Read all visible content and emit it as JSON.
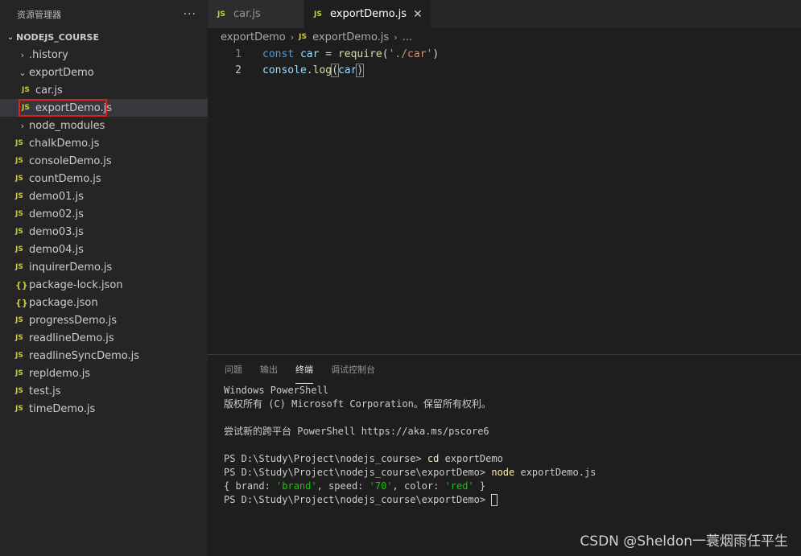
{
  "sidebar": {
    "title": "资源管理器",
    "more": "···",
    "section": "NODEJS_COURSE",
    "items": [
      {
        "label": ".history",
        "type": "folder",
        "open": false,
        "indent": 1
      },
      {
        "label": "exportDemo",
        "type": "folder",
        "open": true,
        "indent": 1
      },
      {
        "label": "car.js",
        "type": "js",
        "indent": 2
      },
      {
        "label": "exportDemo.js",
        "type": "js",
        "indent": 2,
        "selected": true
      },
      {
        "label": "node_modules",
        "type": "folder",
        "open": false,
        "indent": 1
      },
      {
        "label": "chalkDemo.js",
        "type": "js",
        "indent": 1
      },
      {
        "label": "consoleDemo.js",
        "type": "js",
        "indent": 1
      },
      {
        "label": "countDemo.js",
        "type": "js",
        "indent": 1
      },
      {
        "label": "demo01.js",
        "type": "js",
        "indent": 1
      },
      {
        "label": "demo02.js",
        "type": "js",
        "indent": 1
      },
      {
        "label": "demo03.js",
        "type": "js",
        "indent": 1
      },
      {
        "label": "demo04.js",
        "type": "js",
        "indent": 1
      },
      {
        "label": "inquirerDemo.js",
        "type": "js",
        "indent": 1
      },
      {
        "label": "package-lock.json",
        "type": "json",
        "indent": 1
      },
      {
        "label": "package.json",
        "type": "json",
        "indent": 1
      },
      {
        "label": "progressDemo.js",
        "type": "js",
        "indent": 1
      },
      {
        "label": "readlineDemo.js",
        "type": "js",
        "indent": 1
      },
      {
        "label": "readlineSyncDemo.js",
        "type": "js",
        "indent": 1
      },
      {
        "label": "repldemo.js",
        "type": "js",
        "indent": 1
      },
      {
        "label": "test.js",
        "type": "js",
        "indent": 1
      },
      {
        "label": "timeDemo.js",
        "type": "js",
        "indent": 1
      }
    ]
  },
  "icons": {
    "js": "JS",
    "json": "{}",
    "chevron_right": "›",
    "chevron_down": "⌄"
  },
  "tabs": [
    {
      "label": "car.js",
      "active": false
    },
    {
      "label": "exportDemo.js",
      "active": true,
      "close": "✕"
    }
  ],
  "breadcrumb": {
    "folder": "exportDemo",
    "file": "exportDemo.js",
    "more": "..."
  },
  "code": {
    "line1_no": "1",
    "line2_no": "2",
    "l1_const": "const",
    "l1_var": "car",
    "l1_eq": "=",
    "l1_fn": "require",
    "l1_open": "(",
    "l1_str": "'./car'",
    "l1_close": ")",
    "l2_obj": "console",
    "l2_dot": ".",
    "l2_fn": "log",
    "l2_open": "(",
    "l2_arg": "car",
    "l2_close": ")"
  },
  "panel": {
    "tabs": [
      "问题",
      "输出",
      "终端",
      "调试控制台"
    ],
    "active_tab": "终端"
  },
  "terminal": {
    "l1": "Windows PowerShell",
    "l2": "版权所有 (C) Microsoft Corporation。保留所有权利。",
    "l3": "尝试新的跨平台 PowerShell https://aka.ms/pscore6",
    "l4_prompt": "PS D:\\Study\\Project\\nodejs_course> ",
    "l4_cmd": "cd",
    "l4_arg": " exportDemo",
    "l5_prompt": "PS D:\\Study\\Project\\nodejs_course\\exportDemo> ",
    "l5_cmd": "node",
    "l5_arg": " exportDemo.js",
    "l6_a": "{ brand: ",
    "l6_b": "'brand'",
    "l6_c": ", speed: ",
    "l6_d": "'70'",
    "l6_e": ", color: ",
    "l6_f": "'red'",
    "l6_g": " }",
    "l7_prompt": "PS D:\\Study\\Project\\nodejs_course\\exportDemo> "
  },
  "watermark": "CSDN @Sheldon一蓑烟雨任平生",
  "colors": {
    "highlight_box": "#e02020",
    "js_icon": "#cbcb41",
    "keyword": "#569cd6",
    "string": "#ce9178"
  }
}
